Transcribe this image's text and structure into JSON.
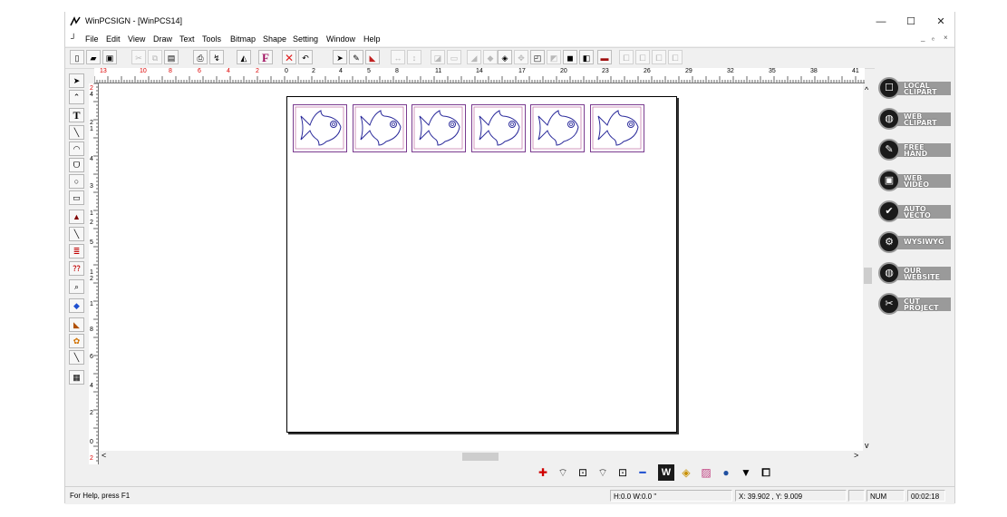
{
  "window": {
    "title": "WinPCSIGN - [WinPCS14]",
    "controls": {
      "minimize": "—",
      "maximize": "☐",
      "close": "✕"
    },
    "mdi_controls": {
      "minimize": "_",
      "restore": "ₑ",
      "close": "×"
    }
  },
  "menu": [
    "File",
    "Edit",
    "View",
    "Draw",
    "Text",
    "Tools",
    "Bitmap",
    "Shape",
    "Setting",
    "Window",
    "Help"
  ],
  "ruler": {
    "top_labels": [
      "13",
      "10",
      "8",
      "6",
      "4",
      "2",
      "0",
      "2",
      "4",
      "5",
      "8",
      "11",
      "14",
      "17",
      "20",
      "23",
      "26",
      "29",
      "32",
      "35",
      "38",
      "41"
    ],
    "left_labels": [
      "2",
      "4",
      "2",
      "1",
      "4",
      "3",
      "1",
      "2",
      "5",
      "1",
      "2",
      "1",
      "8",
      "6",
      "4",
      "2",
      "0",
      "2"
    ]
  },
  "right_panel": [
    {
      "name": "local-clipart",
      "line1": "LOCAL",
      "line2": "CLIPART",
      "icon": "☐"
    },
    {
      "name": "web-clipart",
      "line1": "WEB",
      "line2": "CLIPART",
      "icon": "◍"
    },
    {
      "name": "free-hand",
      "line1": "FREE",
      "line2": "HAND",
      "icon": "✎"
    },
    {
      "name": "web-video",
      "line1": "WEB",
      "line2": "VIDEO",
      "icon": "▣"
    },
    {
      "name": "auto-vecto",
      "line1": "AUTO",
      "line2": "VECTO",
      "icon": "✔"
    },
    {
      "name": "wysiwyg",
      "line1": "WYSIWYG",
      "line2": "",
      "icon": "⚙"
    },
    {
      "name": "our-website",
      "line1": "OUR",
      "line2": "WEBSITE",
      "icon": "◍"
    },
    {
      "name": "cut-project",
      "line1": "CUT",
      "line2": "PROJECT",
      "icon": "✂"
    }
  ],
  "status": {
    "help": "For Help, press F1",
    "size": "H:0.0  W:0.0 \"",
    "coords": "X: 39.902 , Y: 9.009",
    "num": "NUM",
    "time": "00:02:18"
  },
  "scroll": {
    "up": "^",
    "down": "v",
    "left": "<",
    "right": ">"
  },
  "colors": {
    "fish_stroke": "#2b2b9b",
    "frame_stroke": "#7a3b8f"
  },
  "fish_count": 6
}
